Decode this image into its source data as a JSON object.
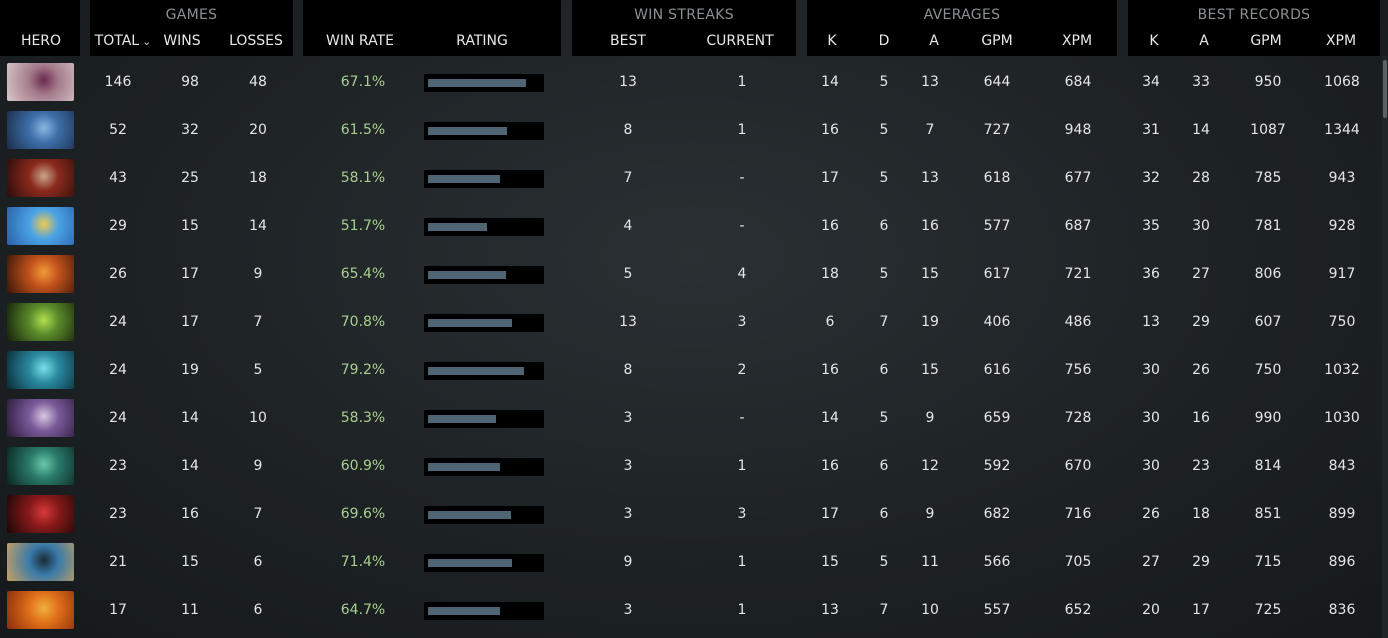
{
  "groups": {
    "games": "GAMES",
    "win_streaks": "WIN STREAKS",
    "averages": "AVERAGES",
    "best_records": "BEST RECORDS"
  },
  "columns": {
    "hero": "HERO",
    "total": "TOTAL",
    "wins": "WINS",
    "losses": "LOSSES",
    "win_rate": "WIN RATE",
    "rating": "RATING",
    "best": "BEST",
    "current": "CURRENT",
    "k": "K",
    "d": "D",
    "a": "A",
    "gpm": "GPM",
    "xpm": "XPM",
    "br_k": "K",
    "br_a": "A",
    "br_gpm": "GPM",
    "br_xpm": "XPM"
  },
  "sort_icon": "chevron-down-icon",
  "rows": [
    {
      "total": "146",
      "wins": "98",
      "losses": "48",
      "win_rate": "67.1%",
      "rating": 0.82,
      "best": "13",
      "current": "1",
      "k": "14",
      "d": "5",
      "a": "13",
      "gpm": "644",
      "xpm": "684",
      "br_k": "34",
      "br_a": "33",
      "br_gpm": "950",
      "br_xpm": "1068",
      "colors": [
        "#a57b8c",
        "#d8c8c8",
        "#6a2a4a"
      ]
    },
    {
      "total": "52",
      "wins": "32",
      "losses": "20",
      "win_rate": "61.5%",
      "rating": 0.66,
      "best": "8",
      "current": "1",
      "k": "16",
      "d": "5",
      "a": "7",
      "gpm": "727",
      "xpm": "948",
      "br_k": "31",
      "br_a": "14",
      "br_gpm": "1087",
      "br_xpm": "1344",
      "colors": [
        "#3d6fa8",
        "#1c2c4a",
        "#8ab6e0"
      ]
    },
    {
      "total": "43",
      "wins": "25",
      "losses": "18",
      "win_rate": "58.1%",
      "rating": 0.6,
      "best": "7",
      "current": "-",
      "k": "17",
      "d": "5",
      "a": "13",
      "gpm": "618",
      "xpm": "677",
      "br_k": "32",
      "br_a": "28",
      "br_gpm": "785",
      "br_xpm": "943",
      "colors": [
        "#8a2a1c",
        "#2a0c0a",
        "#c9a58a"
      ]
    },
    {
      "total": "29",
      "wins": "15",
      "losses": "14",
      "win_rate": "51.7%",
      "rating": 0.49,
      "best": "4",
      "current": "-",
      "k": "16",
      "d": "6",
      "a": "16",
      "gpm": "577",
      "xpm": "687",
      "br_k": "35",
      "br_a": "30",
      "br_gpm": "781",
      "br_xpm": "928",
      "colors": [
        "#4aa3e6",
        "#2a5fa8",
        "#f0c850"
      ]
    },
    {
      "total": "26",
      "wins": "17",
      "losses": "9",
      "win_rate": "65.4%",
      "rating": 0.65,
      "best": "5",
      "current": "4",
      "k": "18",
      "d": "5",
      "a": "15",
      "gpm": "617",
      "xpm": "721",
      "br_k": "36",
      "br_a": "27",
      "br_gpm": "806",
      "br_xpm": "917",
      "colors": [
        "#c2531c",
        "#3a1408",
        "#f09a3a"
      ]
    },
    {
      "total": "24",
      "wins": "17",
      "losses": "7",
      "win_rate": "70.8%",
      "rating": 0.7,
      "best": "13",
      "current": "3",
      "k": "6",
      "d": "7",
      "a": "19",
      "gpm": "406",
      "xpm": "486",
      "br_k": "13",
      "br_a": "29",
      "br_gpm": "607",
      "br_xpm": "750",
      "colors": [
        "#5a8a2a",
        "#141e0a",
        "#b0e050"
      ]
    },
    {
      "total": "24",
      "wins": "19",
      "losses": "5",
      "win_rate": "79.2%",
      "rating": 0.8,
      "best": "8",
      "current": "2",
      "k": "16",
      "d": "6",
      "a": "15",
      "gpm": "616",
      "xpm": "756",
      "br_k": "30",
      "br_a": "26",
      "br_gpm": "750",
      "br_xpm": "1032",
      "colors": [
        "#2a8aa0",
        "#0a2a38",
        "#7ae0e8"
      ]
    },
    {
      "total": "24",
      "wins": "14",
      "losses": "10",
      "win_rate": "58.3%",
      "rating": 0.57,
      "best": "3",
      "current": "-",
      "k": "14",
      "d": "5",
      "a": "9",
      "gpm": "659",
      "xpm": "728",
      "br_k": "30",
      "br_a": "16",
      "br_gpm": "990",
      "br_xpm": "1030",
      "colors": [
        "#7a5a9a",
        "#2a1a3a",
        "#d8c8e0"
      ]
    },
    {
      "total": "23",
      "wins": "14",
      "losses": "9",
      "win_rate": "60.9%",
      "rating": 0.6,
      "best": "3",
      "current": "1",
      "k": "16",
      "d": "6",
      "a": "12",
      "gpm": "592",
      "xpm": "670",
      "br_k": "30",
      "br_a": "23",
      "br_gpm": "814",
      "br_xpm": "843",
      "colors": [
        "#2a7a6a",
        "#0a2420",
        "#6ac8a8"
      ]
    },
    {
      "total": "23",
      "wins": "16",
      "losses": "7",
      "win_rate": "69.6%",
      "rating": 0.69,
      "best": "3",
      "current": "3",
      "k": "17",
      "d": "6",
      "a": "9",
      "gpm": "682",
      "xpm": "716",
      "br_k": "26",
      "br_a": "18",
      "br_gpm": "851",
      "br_xpm": "899",
      "colors": [
        "#8a1a1a",
        "#1a0606",
        "#d83a3a"
      ]
    },
    {
      "total": "21",
      "wins": "15",
      "losses": "6",
      "win_rate": "71.4%",
      "rating": 0.7,
      "best": "9",
      "current": "1",
      "k": "15",
      "d": "5",
      "a": "11",
      "gpm": "566",
      "xpm": "705",
      "br_k": "27",
      "br_a": "29",
      "br_gpm": "715",
      "br_xpm": "896",
      "colors": [
        "#3a7aa8",
        "#c8a060",
        "#1a2a3a"
      ]
    },
    {
      "total": "17",
      "wins": "11",
      "losses": "6",
      "win_rate": "64.7%",
      "rating": 0.6,
      "best": "3",
      "current": "1",
      "k": "13",
      "d": "7",
      "a": "10",
      "gpm": "557",
      "xpm": "652",
      "br_k": "20",
      "br_a": "17",
      "br_gpm": "725",
      "br_xpm": "836",
      "colors": [
        "#e0701a",
        "#8a2a0a",
        "#f0b040"
      ]
    }
  ]
}
